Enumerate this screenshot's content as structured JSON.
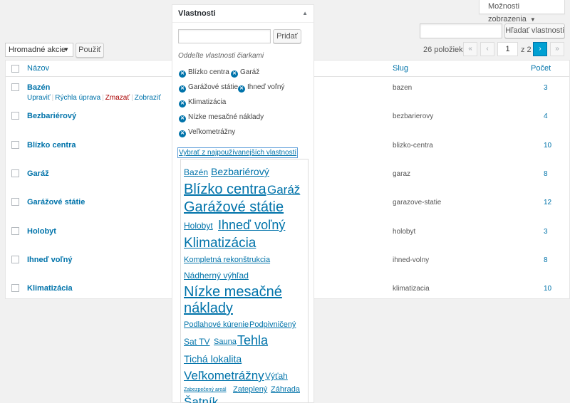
{
  "screen_options": {
    "label": "Možnosti zobrazenia",
    "arrow": "▼"
  },
  "search": {
    "value": "",
    "button": "Hľadať vlastnosti"
  },
  "bulk": {
    "selected": "Hromadné akcie",
    "caret": "▼",
    "apply": "Použiť"
  },
  "pagination": {
    "count": "26 položiek",
    "first": "«",
    "prev": "‹",
    "current": "1",
    "of": "z 2",
    "next": "›",
    "last": "»"
  },
  "table": {
    "headers": {
      "name": "Názov",
      "slug": "Slug",
      "count": "Počet"
    },
    "rows": [
      {
        "name": "Bazén",
        "slug": "bazen",
        "count": "3"
      },
      {
        "name": "Bezbariérový",
        "slug": "bezbarierovy",
        "count": "4"
      },
      {
        "name": "Blízko centra",
        "slug": "blizko-centra",
        "count": "10"
      },
      {
        "name": "Garáž",
        "slug": "garaz",
        "count": "8"
      },
      {
        "name": "Garážové státie",
        "slug": "garazove-statie",
        "count": "12"
      },
      {
        "name": "Holobyt",
        "slug": "holobyt",
        "count": "3"
      },
      {
        "name": "Ihneď voľný",
        "slug": "ihned-volny",
        "count": "8"
      },
      {
        "name": "Klimatizácia",
        "slug": "klimatizacia",
        "count": "10"
      }
    ],
    "row_actions": {
      "edit": "Upraviť",
      "quick": "Rýchla úprava",
      "delete": "Zmazať",
      "view": "Zobraziť",
      "sep": "|"
    }
  },
  "panel": {
    "title": "Vlastnosti",
    "toggle": "▲",
    "input_value": "",
    "add": "Pridať",
    "hint": "Oddeľte vlastnosti čiarkami",
    "remove_glyph": "✕",
    "chosen": [
      "Blízko centra",
      "Garáž",
      "Garážové státie",
      "Ihneď voľný",
      "Klimatizácia",
      "Nízke mesačné náklady",
      "Veľkometrážny"
    ],
    "choose_link": "Vybrať z najpoužívanejších vlastností",
    "cloud": [
      "Bazén",
      "Bezbariérový",
      "Blízko centra",
      "Garáž",
      "Garážové státie",
      "Holobyt",
      "Ihneď voľný",
      "Klimatizácia",
      "Kompletná rekonštrukcia",
      "Nádherný výhľad",
      "Nízke mesačné",
      "náklady",
      "Podlahové kúrenie",
      "Podpivničený",
      "Sat TV",
      "Sauna",
      "Tehla",
      "Tichá lokalita",
      "Veľkometrážny",
      "Výťah",
      "Zabezpečený areál",
      "Zateplený",
      "Záhrada",
      "Šatník"
    ]
  }
}
